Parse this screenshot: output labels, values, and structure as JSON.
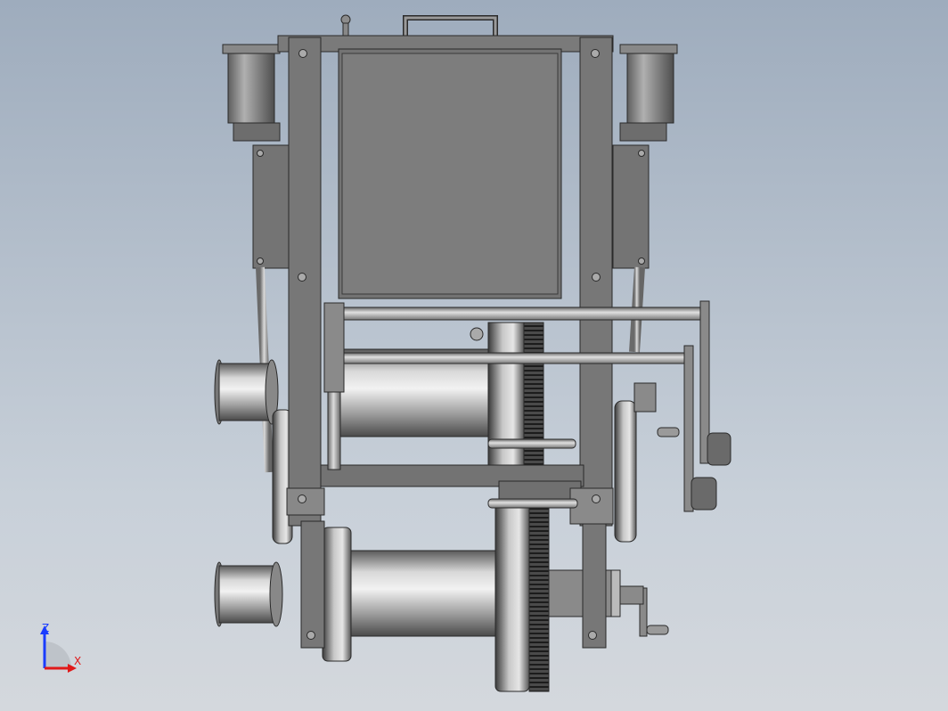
{
  "viewport": {
    "view_name": "",
    "background_top": "#9eacbd",
    "background_bottom": "#d4d8dd"
  },
  "model": {
    "part_color": "#7d7d7d",
    "shaded_metal_color": "#b5b5b5",
    "edge_color": "#2a2a2a"
  },
  "triad": {
    "z_label": "Z",
    "x_label": "X",
    "z_color": "#1a3cff",
    "x_color": "#e01818"
  }
}
